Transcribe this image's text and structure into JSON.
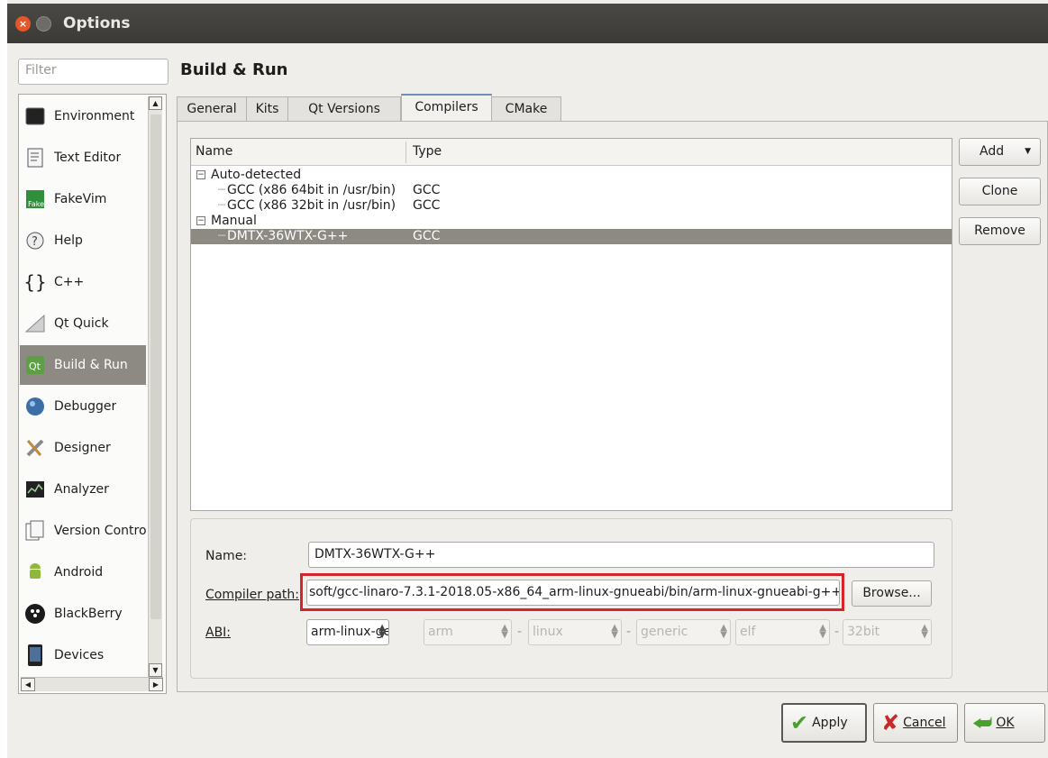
{
  "window": {
    "title": "Options"
  },
  "filter": {
    "placeholder": "Filter"
  },
  "page_title": "Build & Run",
  "sidebar": {
    "items": [
      {
        "label": "Environment",
        "icon": "monitor-icon"
      },
      {
        "label": "Text Editor",
        "icon": "text-document-icon"
      },
      {
        "label": "FakeVim",
        "icon": "fakevim-icon"
      },
      {
        "label": "Help",
        "icon": "help-icon"
      },
      {
        "label": "C++",
        "icon": "braces-icon"
      },
      {
        "label": "Qt Quick",
        "icon": "qt-quick-icon"
      },
      {
        "label": "Build & Run",
        "icon": "build-run-icon"
      },
      {
        "label": "Debugger",
        "icon": "debugger-icon"
      },
      {
        "label": "Designer",
        "icon": "designer-icon"
      },
      {
        "label": "Analyzer",
        "icon": "analyzer-icon"
      },
      {
        "label": "Version Contro",
        "icon": "version-control-icon"
      },
      {
        "label": "Android",
        "icon": "android-icon"
      },
      {
        "label": "BlackBerry",
        "icon": "blackberry-icon"
      },
      {
        "label": "Devices",
        "icon": "devices-icon"
      }
    ],
    "active_index": 6
  },
  "tabs": [
    {
      "label": "General"
    },
    {
      "label": "Kits"
    },
    {
      "label": "Qt Versions"
    },
    {
      "label": "Compilers"
    },
    {
      "label": "CMake"
    }
  ],
  "active_tab": "Compilers",
  "compiler_tree": {
    "columns": [
      "Name",
      "Type"
    ],
    "groups": [
      {
        "label": "Auto-detected",
        "items": [
          {
            "name": "GCC (x86 64bit in /usr/bin)",
            "type": "GCC"
          },
          {
            "name": "GCC (x86 32bit in /usr/bin)",
            "type": "GCC"
          }
        ]
      },
      {
        "label": "Manual",
        "items": [
          {
            "name": "DMTX-36WTX-G++",
            "type": "GCC",
            "selected": true
          }
        ]
      }
    ]
  },
  "side_buttons": {
    "add": "Add",
    "clone": "Clone",
    "remove": "Remove"
  },
  "details": {
    "name_label": "Name:",
    "name_value": "DMTX-36WTX-G++",
    "compiler_path_label": "Compiler path:",
    "compiler_path_value": "soft/gcc-linaro-7.3.1-2018.05-x86_64_arm-linux-gnueabi/bin/arm-linux-gnueabi-g++",
    "browse": "Browse...",
    "abi_label": "ABI:",
    "abi_combo": "arm-linux-ge",
    "abi_arch": "arm",
    "abi_os": "linux",
    "abi_flavor": "generic",
    "abi_format": "elf",
    "abi_width": "32bit"
  },
  "footer": {
    "apply": "Apply",
    "cancel": "Cancel",
    "ok": "OK"
  },
  "colors": {
    "selection": "#8c8a82",
    "titlebar": "#3f3e3a",
    "highlight_box": "#d6242b"
  }
}
